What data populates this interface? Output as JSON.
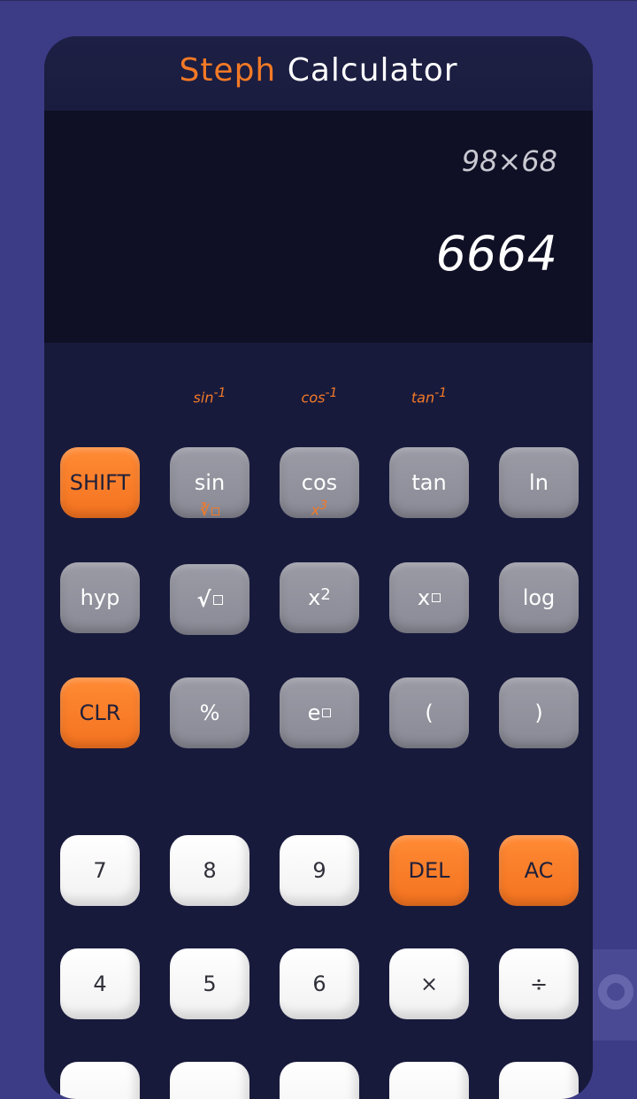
{
  "app": {
    "title_accent": "Steph",
    "title_rest": "Calculator"
  },
  "display": {
    "expression": "98×68",
    "result": "6664"
  },
  "secondary_labels": {
    "sin": "sin",
    "cos": "cos",
    "tan": "tan",
    "inv": "-1",
    "cbrt": "∛",
    "cube_base": "x",
    "cube_exp": "3"
  },
  "keys": {
    "shift": "SHIFT",
    "sin": "sin",
    "cos": "cos",
    "tan": "tan",
    "ln": "ln",
    "hyp": "hyp",
    "sqrt": "√",
    "square_base": "x",
    "square_exp": "2",
    "power_base": "x",
    "log": "log",
    "clr": "CLR",
    "percent": "%",
    "exp_base": "e",
    "lparen": "(",
    "rparen": ")",
    "seven": "7",
    "eight": "8",
    "nine": "9",
    "del": "DEL",
    "ac": "AC",
    "four": "4",
    "five": "5",
    "six": "6",
    "multiply": "×",
    "divide": "÷"
  },
  "colors": {
    "background": "#3c3b85",
    "panel": "#181a3c",
    "display": "#0f0f25",
    "accent": "#f47a26",
    "gray_key": "#8f8f9b",
    "white_key": "#ffffff"
  }
}
